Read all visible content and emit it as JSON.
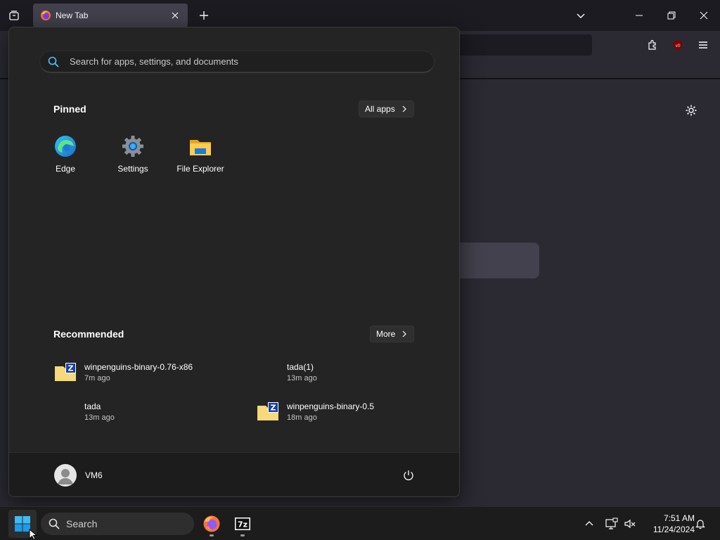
{
  "browser": {
    "tab_title": "New Tab"
  },
  "start_menu": {
    "search_placeholder": "Search for apps, settings, and documents",
    "pinned_title": "Pinned",
    "all_apps_label": "All apps",
    "pinned": [
      {
        "label": "Edge",
        "icon": "edge-icon"
      },
      {
        "label": "Settings",
        "icon": "settings-gear-icon"
      },
      {
        "label": "File Explorer",
        "icon": "folder-icon"
      }
    ],
    "recommended_title": "Recommended",
    "more_label": "More",
    "recommended": [
      {
        "name": "winpenguins-binary-0.76-x86",
        "time": "7m ago",
        "icon": "zip-folder-icon"
      },
      {
        "name": "tada(1)",
        "time": "13m ago",
        "icon": ""
      },
      {
        "name": "tada",
        "time": "13m ago",
        "icon": ""
      },
      {
        "name": "winpenguins-binary-0.5",
        "time": "18m ago",
        "icon": "zip-folder-icon"
      }
    ],
    "user_name": "VM6"
  },
  "taskbar": {
    "search_label": "Search",
    "apps": [
      {
        "name": "firefox",
        "icon": "firefox-icon"
      },
      {
        "name": "7-Zip",
        "icon": "7zip-icon",
        "label": "7z"
      }
    ],
    "time": "7:51 AM",
    "date": "11/24/2024"
  },
  "colors": {
    "accent": "#0078d4",
    "start_bg": "#242424",
    "taskbar_bg": "#1c1c1c"
  }
}
